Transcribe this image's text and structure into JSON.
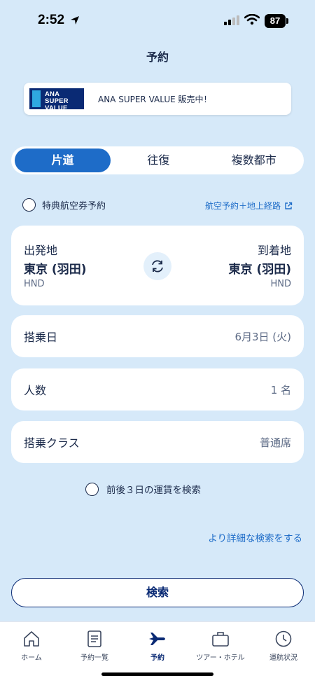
{
  "status": {
    "time": "2:52",
    "battery": "87"
  },
  "header": {
    "title": "予約"
  },
  "banner": {
    "logo_line1": "ANA SUPER",
    "logo_line2": "VALUE",
    "text": "ANA SUPER VALUE 販売中！"
  },
  "trip_type": {
    "tabs": [
      "片道",
      "往復",
      "複数都市"
    ],
    "selected": "片道"
  },
  "award": {
    "label": "特典航空券予約",
    "checked": false
  },
  "route_link": "航空予約＋地上経路",
  "route": {
    "origin_label": "出発地",
    "origin_city": "東京 (羽田)",
    "origin_code": "HND",
    "dest_label": "到着地",
    "dest_city": "東京 (羽田)",
    "dest_code": "HND"
  },
  "date": {
    "label": "搭乗日",
    "value": "6月3日 (火)"
  },
  "passengers": {
    "label": "人数",
    "value": "1 名"
  },
  "cabin": {
    "label": "搭乗クラス",
    "value": "普通席"
  },
  "fare_option": {
    "label": "前後３日の運賃を検索",
    "checked": false
  },
  "detail_link": "より詳細な検索をする",
  "search_button": "検索",
  "tabbar": {
    "items": [
      {
        "label": "ホーム",
        "icon": "home-icon"
      },
      {
        "label": "予約一覧",
        "icon": "document-list-icon"
      },
      {
        "label": "予約",
        "icon": "airplane-icon",
        "active": true
      },
      {
        "label": "ツアー・ホテル",
        "icon": "suitcase-icon"
      },
      {
        "label": "運航状況",
        "icon": "clock-icon"
      }
    ]
  },
  "colors": {
    "accent": "#1e6cc8",
    "navy": "#0a2a74",
    "background": "#d6e9f9"
  }
}
